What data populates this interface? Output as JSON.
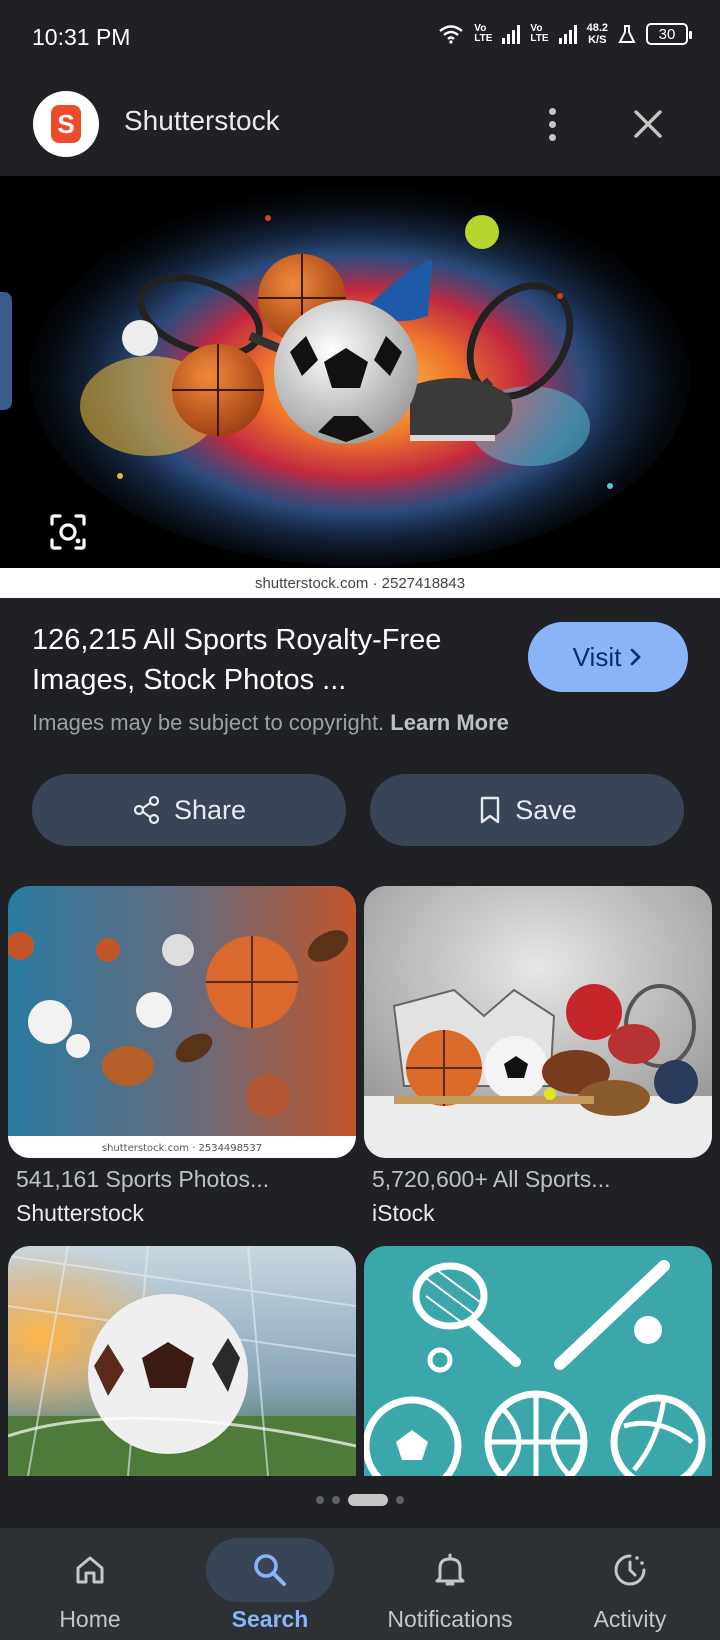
{
  "status_bar": {
    "time": "10:31 PM",
    "lte1": [
      "Vo",
      "LTE"
    ],
    "lte2": [
      "Vo",
      "LTE"
    ],
    "speed": [
      "48.2",
      "K/S"
    ],
    "battery": "30"
  },
  "header": {
    "site_name": "Shutterstock",
    "logo_letter": "S"
  },
  "hero": {
    "caption": "shutterstock.com · 2527418843"
  },
  "result": {
    "title": "126,215 All Sports Royalty-Free Images, Stock Photos ...",
    "visit_label": "Visit",
    "copyright_text": "Images may be subject to copyright.",
    "learn_more": "Learn More"
  },
  "actions": {
    "share_label": "Share",
    "save_label": "Save"
  },
  "related": [
    {
      "caption": "541,161 Sports Photos...",
      "source": "Shutterstock",
      "watermark": "shutterstock.com · 2534498537"
    },
    {
      "caption": "5,720,600+ All Sports...",
      "source": "iStock"
    },
    {
      "caption": "",
      "source": ""
    },
    {
      "caption": "",
      "source": ""
    }
  ],
  "nav": {
    "items": [
      {
        "label": "Home",
        "icon": "home-icon"
      },
      {
        "label": "Search",
        "icon": "search-icon",
        "active": true
      },
      {
        "label": "Notifications",
        "icon": "bell-icon"
      },
      {
        "label": "Activity",
        "icon": "activity-icon"
      }
    ]
  },
  "colors": {
    "background": "#202124",
    "accent": "#8ab4f8",
    "button_bg": "#394457",
    "nav_bg": "#2d3035"
  }
}
